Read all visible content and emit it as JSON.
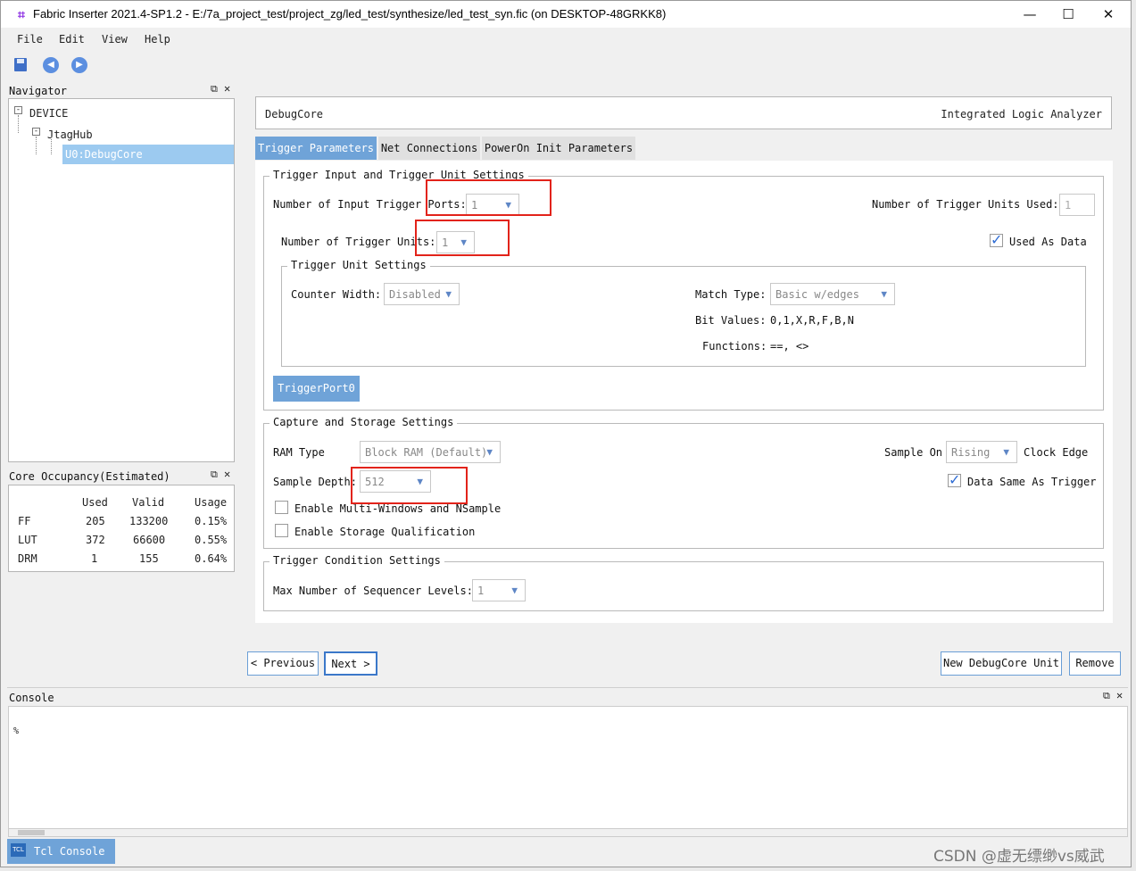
{
  "window": {
    "title": "Fabric Inserter 2021.4-SP1.2 - E:/7a_project_test/project_zg/led_test/synthesize/led_test_syn.fic (on DESKTOP-48GRKK8)",
    "minimize": "—",
    "maximize": "☐",
    "close": "✕"
  },
  "menu": [
    "File",
    "Edit",
    "View",
    "Help"
  ],
  "toolbar": {
    "icons": [
      "save-icon",
      "back-icon",
      "forward-icon"
    ]
  },
  "navigator": {
    "title": "Navigator",
    "tree": [
      {
        "label": "DEVICE"
      },
      {
        "label": "JtagHub"
      },
      {
        "label": "U0:DebugCore"
      }
    ]
  },
  "occupancy": {
    "title": "Core Occupancy(Estimated)",
    "headers": [
      "",
      "Used",
      "Valid",
      "Usage"
    ],
    "rows": [
      [
        "FF",
        "205",
        "133200",
        "0.15%"
      ],
      [
        "LUT",
        "372",
        "66600",
        "0.55%"
      ],
      [
        "DRM",
        "1",
        "155",
        "0.64%"
      ]
    ]
  },
  "header": {
    "left": "DebugCore",
    "right": "Integrated Logic Analyzer"
  },
  "tabs": [
    "Trigger Parameters",
    "Net Connections",
    "PowerOn Init Parameters"
  ],
  "trigger": {
    "group_title": "Trigger Input and Trigger Unit Settings",
    "num_input_ports_label": "Number of Input Trigger Ports:",
    "num_input_ports_value": "1",
    "units_used_label": "Number of Trigger Units Used:",
    "units_used_value": "1",
    "num_units_label": "Number of Trigger Units:",
    "num_units_value": "1",
    "used_as_data": "Used As Data",
    "unit_group_title": "Trigger Unit Settings",
    "counter_width_label": "Counter Width:",
    "counter_width_value": "Disabled",
    "match_type_label": "Match Type:",
    "match_type_value": "Basic w/edges",
    "bit_values_label": "Bit Values:",
    "bit_values": "0,1,X,R,F,B,N",
    "functions_label": "Functions:",
    "functions": "==, <>",
    "port_button": "TriggerPort0"
  },
  "capture": {
    "group_title": "Capture and Storage Settings",
    "ram_type_label": "RAM Type",
    "ram_type_value": "Block RAM (Default)",
    "sample_on_label": "Sample On",
    "sample_on_value": "Rising",
    "clock_edge": "Clock Edge",
    "sample_depth_label": "Sample Depth:",
    "sample_depth_value": "512",
    "data_same": "Data Same As Trigger",
    "multi_windows": "Enable Multi-Windows and NSample",
    "storage_qual": "Enable Storage Qualification"
  },
  "condition": {
    "group_title": "Trigger Condition Settings",
    "max_levels_label": "Max Number of Sequencer Levels:",
    "max_levels_value": "1"
  },
  "buttons": {
    "previous": "< Previous",
    "next": "Next >",
    "new_unit": "New DebugCore Unit",
    "remove": "Remove"
  },
  "console": {
    "title": "Console",
    "prompt": "%",
    "tab": "Tcl Console",
    "tab_icon": "TCL"
  },
  "watermark": "CSDN @虚无缥缈vs威武",
  "colors": {
    "accent": "#6fa3d8",
    "selection": "#9ccaf0",
    "highlight_box": "#e2231a"
  }
}
